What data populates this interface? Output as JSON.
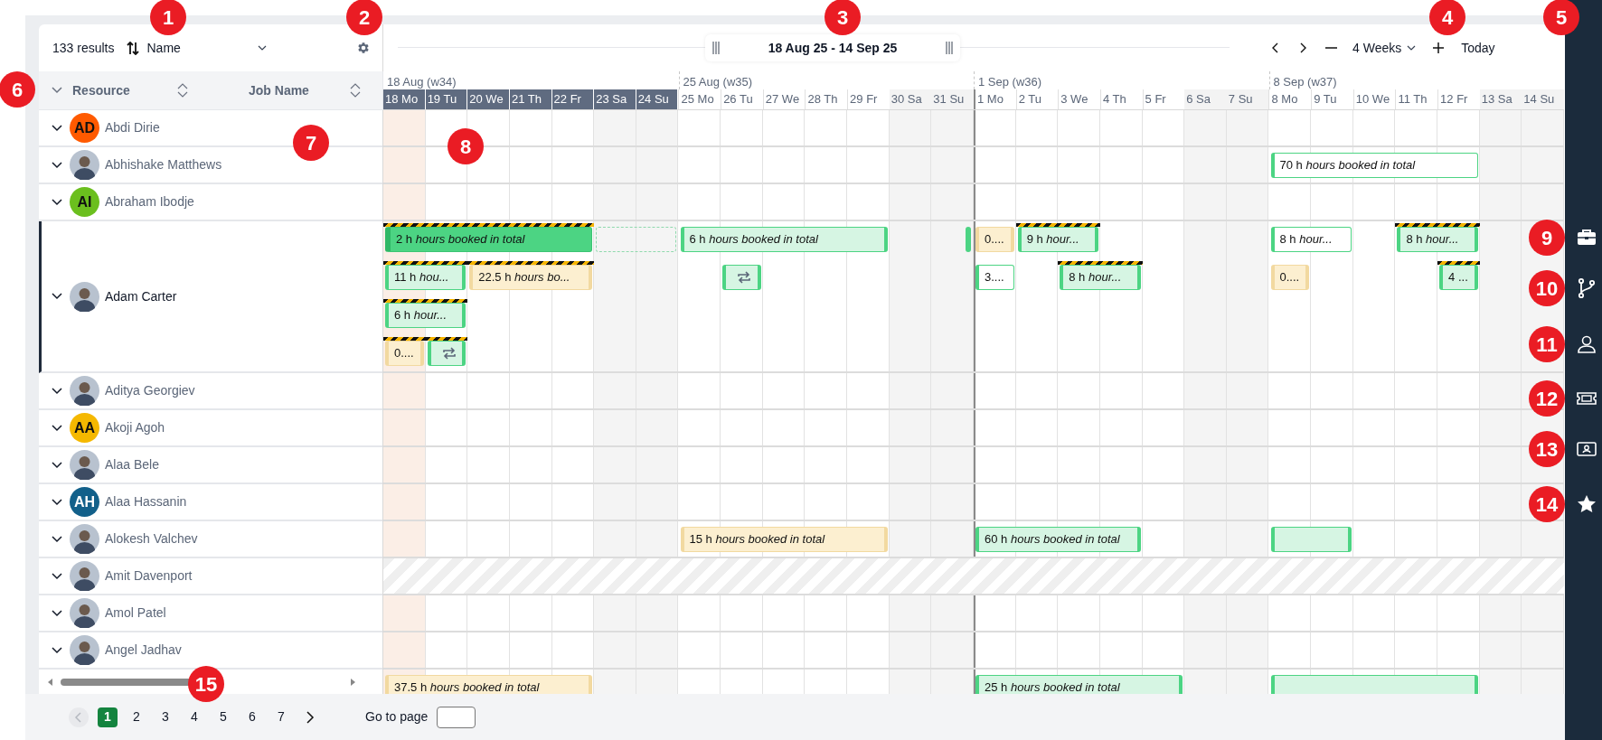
{
  "toolbar": {
    "results": "133 results",
    "sort_label": "Name"
  },
  "columns": [
    {
      "label": "Resource"
    },
    {
      "label": "Job Name"
    }
  ],
  "range": {
    "label": "18 Aug 25 - 14 Sep 25",
    "period": "4 Weeks",
    "today": "Today"
  },
  "weeks": [
    {
      "label": "18 Aug (w34)"
    },
    {
      "label": "25 Aug (w35)"
    },
    {
      "label": "1 Sep (w36)"
    },
    {
      "label": "8 Sep (w37)"
    }
  ],
  "days": [
    {
      "label": "18 Mo",
      "weekend": false,
      "highlighted": true,
      "today": true,
      "divider": false
    },
    {
      "label": "19 Tu",
      "weekend": false,
      "highlighted": true,
      "today": false,
      "divider": false
    },
    {
      "label": "20 We",
      "weekend": false,
      "highlighted": true,
      "today": false,
      "divider": false
    },
    {
      "label": "21 Th",
      "weekend": false,
      "highlighted": true,
      "today": false,
      "divider": false
    },
    {
      "label": "22 Fr",
      "weekend": false,
      "highlighted": true,
      "today": false,
      "divider": false
    },
    {
      "label": "23 Sa",
      "weekend": true,
      "highlighted": true,
      "today": false,
      "divider": false
    },
    {
      "label": "24 Su",
      "weekend": true,
      "highlighted": true,
      "today": false,
      "divider": false
    },
    {
      "label": "25 Mo",
      "weekend": false,
      "highlighted": false,
      "today": false,
      "divider": false
    },
    {
      "label": "26 Tu",
      "weekend": false,
      "highlighted": false,
      "today": false,
      "divider": false
    },
    {
      "label": "27 We",
      "weekend": false,
      "highlighted": false,
      "today": false,
      "divider": false
    },
    {
      "label": "28 Th",
      "weekend": false,
      "highlighted": false,
      "today": false,
      "divider": false
    },
    {
      "label": "29 Fr",
      "weekend": false,
      "highlighted": false,
      "today": false,
      "divider": false
    },
    {
      "label": "30 Sa",
      "weekend": true,
      "highlighted": false,
      "today": false,
      "divider": false
    },
    {
      "label": "31 Su",
      "weekend": true,
      "highlighted": false,
      "today": false,
      "divider": false
    },
    {
      "label": "1 Mo",
      "weekend": false,
      "highlighted": false,
      "today": false,
      "divider": true
    },
    {
      "label": "2 Tu",
      "weekend": false,
      "highlighted": false,
      "today": false,
      "divider": false
    },
    {
      "label": "3 We",
      "weekend": false,
      "highlighted": false,
      "today": false,
      "divider": false
    },
    {
      "label": "4 Th",
      "weekend": false,
      "highlighted": false,
      "today": false,
      "divider": false
    },
    {
      "label": "5 Fr",
      "weekend": false,
      "highlighted": false,
      "today": false,
      "divider": false
    },
    {
      "label": "6 Sa",
      "weekend": true,
      "highlighted": false,
      "today": false,
      "divider": false
    },
    {
      "label": "7 Su",
      "weekend": true,
      "highlighted": false,
      "today": false,
      "divider": false
    },
    {
      "label": "8 Mo",
      "weekend": false,
      "highlighted": false,
      "today": false,
      "divider": false
    },
    {
      "label": "9 Tu",
      "weekend": false,
      "highlighted": false,
      "today": false,
      "divider": false
    },
    {
      "label": "10 We",
      "weekend": false,
      "highlighted": false,
      "today": false,
      "divider": false
    },
    {
      "label": "11 Th",
      "weekend": false,
      "highlighted": false,
      "today": false,
      "divider": false
    },
    {
      "label": "12 Fr",
      "weekend": false,
      "highlighted": false,
      "today": false,
      "divider": false
    },
    {
      "label": "13 Sa",
      "weekend": true,
      "highlighted": false,
      "today": false,
      "divider": false
    },
    {
      "label": "14 Su",
      "weekend": true,
      "highlighted": false,
      "today": false,
      "divider": false
    }
  ],
  "rows": [
    {
      "name": "Abdi Dirie",
      "avatar": {
        "kind": "initials",
        "text": "AD",
        "color": "#ff5a00"
      },
      "selected": false,
      "unavailable": false,
      "lanes": []
    },
    {
      "name": "Abhishake Matthews",
      "avatar": {
        "kind": "photo"
      },
      "selected": false,
      "unavailable": false,
      "lanes": [
        [
          {
            "kind": "outline",
            "text": "70 h *hours booked in total*",
            "flagged": false
          }
        ]
      ]
    },
    {
      "name": "Abraham Ibodje",
      "avatar": {
        "kind": "initials",
        "text": "AI",
        "color": "#6bbf1e"
      },
      "selected": false,
      "unavailable": false,
      "lanes": []
    },
    {
      "name": "Adam Carter",
      "avatar": {
        "kind": "photo"
      },
      "selected": true,
      "unavailable": false,
      "lanes": [
        [
          {
            "kind": "solid",
            "text": "2 h *hours booked in total*",
            "flagged": true
          },
          {
            "kind": "ghost",
            "flagged": false
          },
          {
            "kind": "light",
            "text": "6 h *hours booked in total*",
            "flagged": false
          },
          {
            "kind": "edge",
            "flagged": false
          },
          {
            "kind": "pending",
            "text": "0....",
            "flagged": false
          },
          {
            "kind": "light",
            "text": "9 h *hour...*",
            "flagged": true
          },
          {
            "kind": "outline",
            "text": "8 h *hour...*",
            "flagged": false
          },
          {
            "kind": "light",
            "text": "8 h *hour...*",
            "flagged": true
          }
        ],
        [
          {
            "kind": "light",
            "text": "11 h *hou...*",
            "flagged": true
          },
          {
            "kind": "pending",
            "text": "22.5 h *hours bo...*",
            "flagged": true
          },
          {
            "kind": "repeat",
            "flagged": false
          },
          {
            "kind": "outline",
            "text": "3....",
            "flagged": false
          },
          {
            "kind": "light",
            "text": "8 h *hour...*",
            "flagged": true
          },
          {
            "kind": "pending",
            "text": "0....",
            "flagged": false
          },
          {
            "kind": "light",
            "text": "4 ...",
            "flagged": true
          }
        ],
        [
          {
            "kind": "light",
            "text": "6 h *hour...*",
            "flagged": true
          }
        ],
        [
          {
            "kind": "pending",
            "text": "0....",
            "flagged": true
          },
          {
            "kind": "repeat",
            "flagged": true
          }
        ]
      ]
    },
    {
      "name": "Aditya Georgiev",
      "avatar": {
        "kind": "photo"
      },
      "selected": false,
      "unavailable": false,
      "lanes": []
    },
    {
      "name": "Akoji Agoh",
      "avatar": {
        "kind": "initials",
        "text": "AA",
        "color": "#f5b800"
      },
      "selected": false,
      "unavailable": false,
      "lanes": []
    },
    {
      "name": "Alaa Bele",
      "avatar": {
        "kind": "photo"
      },
      "selected": false,
      "unavailable": false,
      "lanes": []
    },
    {
      "name": "Alaa Hassanin",
      "avatar": {
        "kind": "initials",
        "text": "AH",
        "color": "#12608a"
      },
      "selected": false,
      "unavailable": false,
      "lanes": []
    },
    {
      "name": "Alokesh Valchev",
      "avatar": {
        "kind": "photo"
      },
      "selected": false,
      "unavailable": false,
      "lanes": [
        [
          {
            "kind": "pending",
            "text": "15 h *hours booked in total*",
            "flagged": false
          },
          {
            "kind": "light",
            "text": "60 h *hours booked in total*",
            "flagged": false
          },
          {
            "kind": "light",
            "flagged": false
          }
        ]
      ]
    },
    {
      "name": "Amit Davenport",
      "avatar": {
        "kind": "photo"
      },
      "selected": false,
      "unavailable": true,
      "lanes": []
    },
    {
      "name": "Amol Patel",
      "avatar": {
        "kind": "photo"
      },
      "selected": false,
      "unavailable": false,
      "lanes": []
    },
    {
      "name": "Angel Jadhav",
      "avatar": {
        "kind": "photo"
      },
      "selected": false,
      "unavailable": false,
      "lanes": []
    }
  ],
  "partial_row": {
    "lanes": [
      [
        {
          "kind": "pending",
          "text": "37.5 h *hours booked in total*",
          "flagged": false
        },
        {
          "kind": "light",
          "text": "25 h *hours booked in total*",
          "flagged": false
        },
        {
          "kind": "light",
          "flagged": false
        }
      ]
    ]
  },
  "pagination": {
    "pages": [
      {
        "label": "1",
        "selected": true
      },
      {
        "label": "2",
        "selected": false
      },
      {
        "label": "3",
        "selected": false
      },
      {
        "label": "4",
        "selected": false
      },
      {
        "label": "5",
        "selected": false
      },
      {
        "label": "6",
        "selected": false
      },
      {
        "label": "7",
        "selected": false
      }
    ],
    "goto_label": "Go to page"
  },
  "sidebar": {
    "items": [
      {
        "kind": "briefcase"
      },
      {
        "kind": "branch"
      },
      {
        "kind": "person"
      },
      {
        "kind": "ticket"
      },
      {
        "kind": "idcard"
      },
      {
        "kind": "star"
      }
    ]
  },
  "callouts": [
    {
      "text": "1"
    },
    {
      "text": "2"
    },
    {
      "text": "3"
    },
    {
      "text": "4"
    },
    {
      "text": "5"
    },
    {
      "text": "6"
    },
    {
      "text": "7"
    },
    {
      "text": "8"
    },
    {
      "text": "9"
    },
    {
      "text": "10"
    },
    {
      "text": "11"
    },
    {
      "text": "12"
    },
    {
      "text": "13"
    },
    {
      "text": "14"
    },
    {
      "text": "15"
    }
  ]
}
